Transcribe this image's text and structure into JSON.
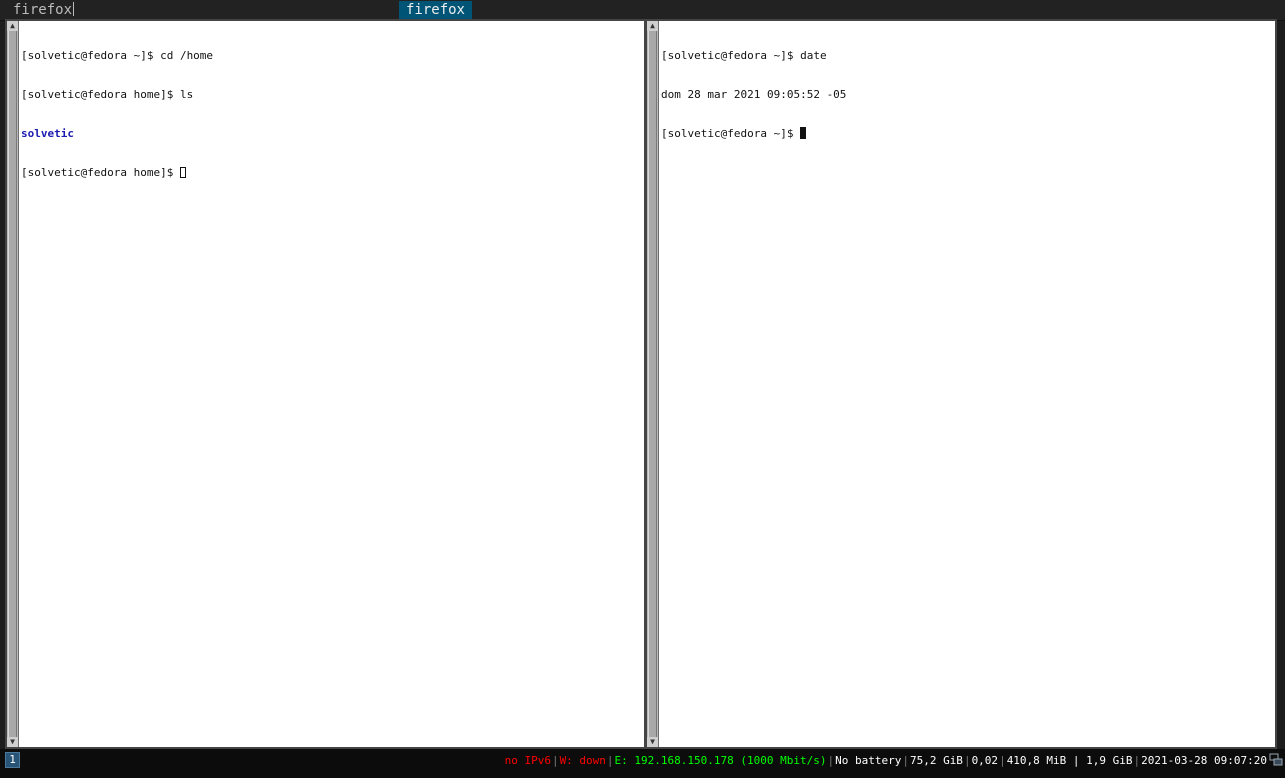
{
  "dmenu": {
    "input": "firefox",
    "selected": "firefox"
  },
  "left_terminal": {
    "lines": [
      "[solvetic@fedora ~]$ cd /home",
      "[solvetic@fedora home]$ ls",
      "solvetic",
      "[solvetic@fedora home]$ "
    ]
  },
  "right_terminal": {
    "lines": [
      "[solvetic@fedora ~]$ date",
      "dom 28 mar 2021 09:05:52 -05",
      "[solvetic@fedora ~]$ "
    ]
  },
  "bar": {
    "workspace": "1",
    "ipv6": "no IPv6",
    "wireless": "W: down",
    "ethernet": "E: 192.168.150.178 (1000 Mbit/s)",
    "battery": "No battery",
    "disk": "75,2 GiB",
    "load": "0,02",
    "memory": "410,8 MiB | 1,9 GiB",
    "datetime": "2021-03-28 09:07:20",
    "separator": "|",
    "tray_icon": "network-icon"
  },
  "colors": {
    "dmenu_bg": "#222222",
    "dmenu_selected_bg": "#005577",
    "workspace_bg": "#285577",
    "status_red": "#ff0000",
    "status_green": "#00ff00",
    "dir_color": "#1b1bb0"
  }
}
